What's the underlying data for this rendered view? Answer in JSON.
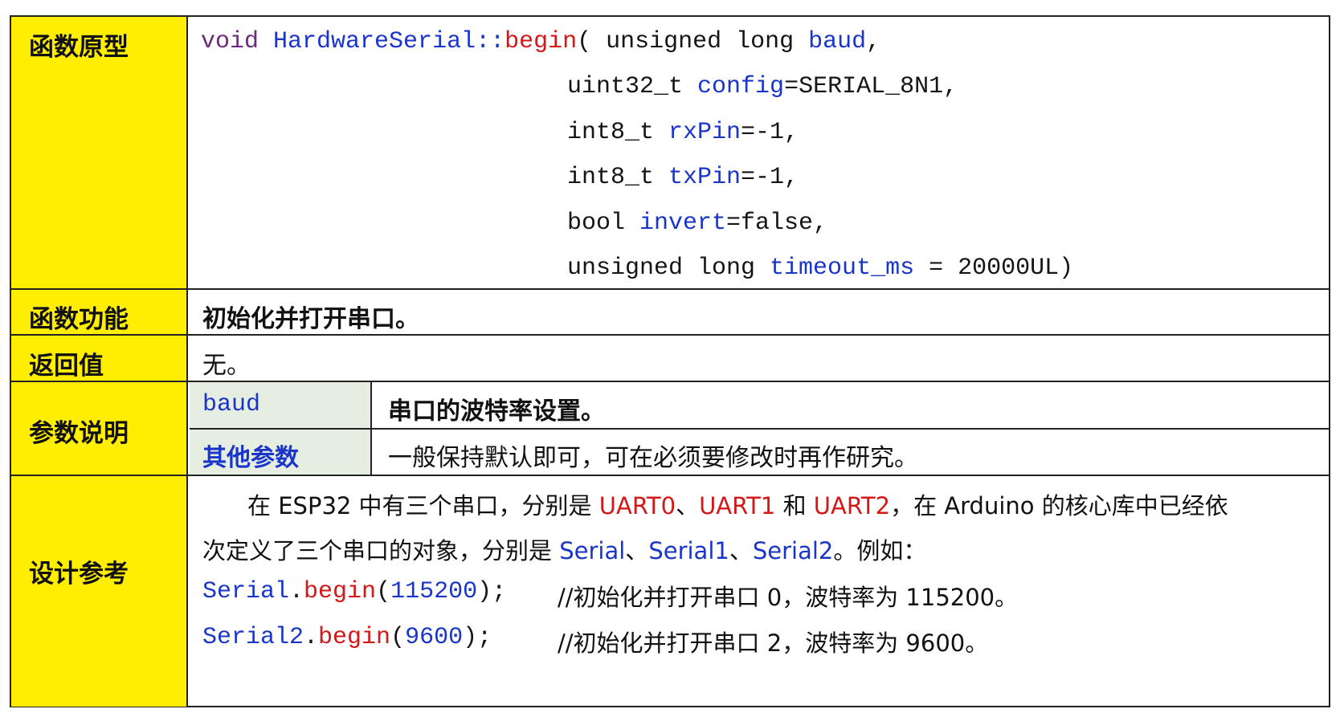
{
  "rows": {
    "prototype": {
      "label": "函数原型",
      "lines": [
        {
          "void": "void",
          "cls": "HardwareSerial::",
          "fn": "begin",
          "rest": "( unsigned long ",
          "param": "baud",
          "tail": ","
        },
        {
          "type": "uint32_t ",
          "param": "config",
          "tail": "=SERIAL_8N1,"
        },
        {
          "type": "int8_t ",
          "param": "rxPin",
          "tail": "=-1,"
        },
        {
          "type": "int8_t ",
          "param": "txPin",
          "tail": "=-1,"
        },
        {
          "type": "bool ",
          "param": "invert",
          "tail": "=false,"
        },
        {
          "type": "unsigned long ",
          "param": "timeout_ms",
          "tail": " = 20000UL)"
        }
      ]
    },
    "function": {
      "label": "函数功能",
      "text": "初始化并打开串口。"
    },
    "return": {
      "label": "返回值",
      "text": "无。"
    },
    "params": {
      "label": "参数说明",
      "items": [
        {
          "name": "baud",
          "desc": "串口的波特率设置。"
        },
        {
          "name": "其他参数",
          "desc": "一般保持默认即可，可在必须要修改时再作研究。"
        }
      ]
    },
    "design": {
      "label": "设计参考",
      "line1": {
        "a": "在 ESP32 中有三个串口，分别是 ",
        "u0": "UART0",
        "s1": "、",
        "u1": "UART1",
        "s2": " 和 ",
        "u2": "UART2",
        "b": "，在 Arduino 的核心库中已经依"
      },
      "line2": {
        "a": "次定义了三个串口的对象，分别是 ",
        "s0": "Serial",
        "c1": "、",
        "s1": "Serial1",
        "c2": "、",
        "s2": "Serial2",
        "b": "。例如："
      },
      "code1": {
        "obj": "Serial",
        "dot": ".",
        "fn": "begin",
        "lp": "(",
        "arg": "115200",
        "rp": ");",
        "comment": "//初始化并打开串口 0，波特率为 115200。"
      },
      "code2": {
        "obj": "Serial2",
        "dot": ".",
        "fn": "begin",
        "lp": "(",
        "arg": "9600",
        "rp": ");",
        "comment": "//初始化并打开串口 2，波特率为 9600。"
      }
    }
  },
  "colors": {
    "header_bg": "#ffee00",
    "param_bg": "#e6eee2",
    "keyword": "#6b2a7a",
    "identifier": "#1a35c9",
    "function": "#d41818"
  }
}
